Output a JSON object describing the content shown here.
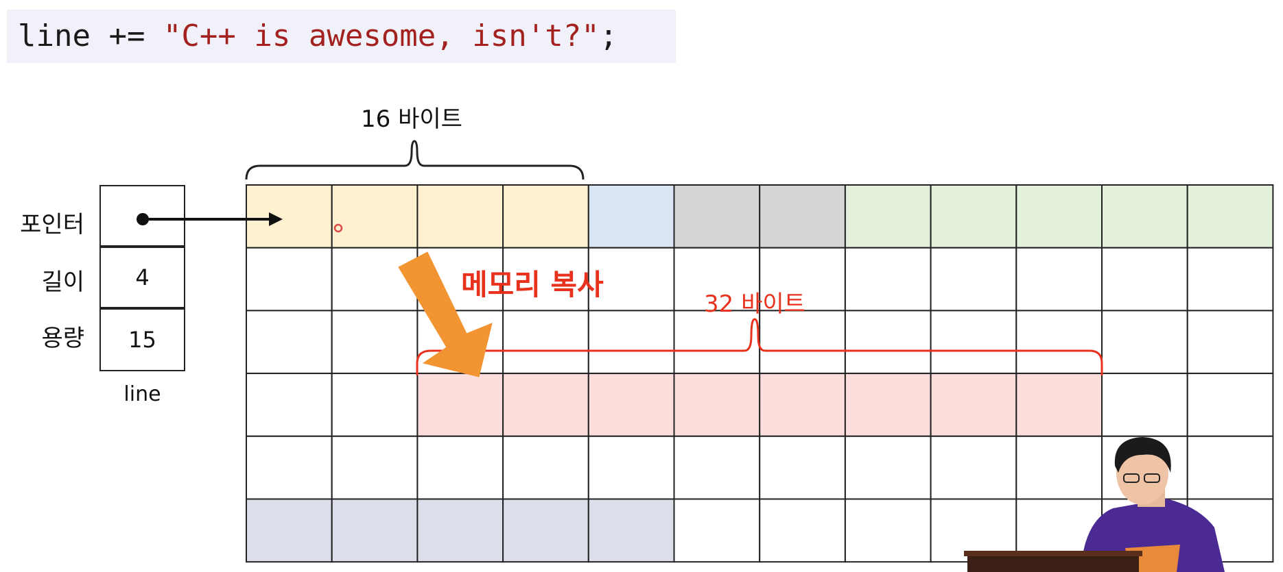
{
  "code": {
    "prefix": "line += ",
    "string": "\"C++ is awesome, isn't?\"",
    "suffix": ";"
  },
  "fields": {
    "pointer_label": "포인터",
    "length_label": "길이",
    "length_value": "4",
    "capacity_label": "용량",
    "capacity_value": "15",
    "var_name": "line"
  },
  "annotations": {
    "old_block_size": "16 바이트",
    "new_block_size": "32 바이트",
    "copy_label": "메모리 복사"
  },
  "memory": {
    "rows": 6,
    "cols": 12,
    "colors": {
      "old_buffer": "#fff1cf",
      "blue": "#dbe6f5",
      "gray": "#d6d4d5",
      "green": "#e3f0dc",
      "new_buffer": "#fddedd",
      "slate": "#dcdfe9",
      "empty": "#ffffff"
    },
    "cells": [
      [
        "old_buffer",
        "old_buffer",
        "old_buffer",
        "old_buffer",
        "blue",
        "gray",
        "gray",
        "green",
        "green",
        "green",
        "green",
        "green"
      ],
      [
        "empty",
        "empty",
        "empty",
        "empty",
        "empty",
        "empty",
        "empty",
        "empty",
        "empty",
        "empty",
        "empty",
        "empty"
      ],
      [
        "empty",
        "empty",
        "empty",
        "empty",
        "empty",
        "empty",
        "empty",
        "empty",
        "empty",
        "empty",
        "empty",
        "empty"
      ],
      [
        "empty",
        "empty",
        "new_buffer",
        "new_buffer",
        "new_buffer",
        "new_buffer",
        "new_buffer",
        "new_buffer",
        "new_buffer",
        "new_buffer",
        "empty",
        "empty"
      ],
      [
        "empty",
        "empty",
        "empty",
        "empty",
        "empty",
        "empty",
        "empty",
        "empty",
        "empty",
        "empty",
        "empty",
        "empty"
      ],
      [
        "slate",
        "slate",
        "slate",
        "slate",
        "slate",
        "empty",
        "empty",
        "empty",
        "empty",
        "empty",
        "empty",
        "empty"
      ]
    ]
  },
  "accent_color": "#e8321e",
  "copy_arrow_color": "#f39433"
}
